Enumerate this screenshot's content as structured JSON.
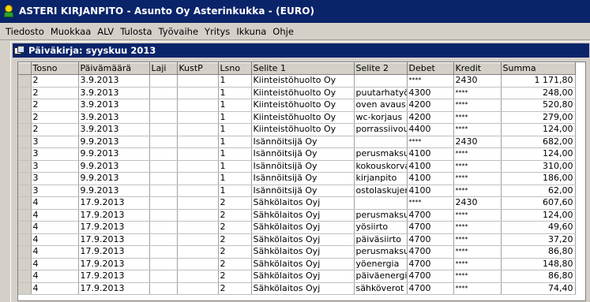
{
  "window": {
    "title": "ASTERI KIRJANPITO - Asunto Oy Asterinkukka - (EURO)"
  },
  "menu": [
    "Tiedosto",
    "Muokkaa",
    "ALV",
    "Tulosta",
    "Työvaihe",
    "Yritys",
    "Ikkuna",
    "Ohje"
  ],
  "child_window": {
    "title": "Päiväkirja: syyskuu 2013"
  },
  "grid": {
    "columns": [
      "Tosno",
      "Päivämäärä",
      "Laji",
      "KustP",
      "Lsno",
      "Selite 1",
      "Selite 2",
      "Debet",
      "Kredit",
      "Summa"
    ],
    "rows": [
      [
        "2",
        "3.9.2013",
        "",
        "",
        "1",
        "Kiinteistöhuolto Oy",
        "",
        "****",
        "2430",
        "1 171,80"
      ],
      [
        "2",
        "3.9.2013",
        "",
        "",
        "1",
        "Kiinteistöhuolto Oy",
        "puutarhatyöt",
        "4300",
        "****",
        "248,00"
      ],
      [
        "2",
        "3.9.2013",
        "",
        "",
        "1",
        "Kiinteistöhuolto Oy",
        "oven avaus",
        "4200",
        "****",
        "520,80"
      ],
      [
        "2",
        "3.9.2013",
        "",
        "",
        "1",
        "Kiinteistöhuolto Oy",
        "wc-korjaus",
        "4200",
        "****",
        "279,00"
      ],
      [
        "2",
        "3.9.2013",
        "",
        "",
        "1",
        "Kiinteistöhuolto Oy",
        "porrassiivous",
        "4400",
        "****",
        "124,00"
      ],
      [
        "3",
        "9.9.2013",
        "",
        "",
        "1",
        "Isännöitsijä Oy",
        "",
        "****",
        "2430",
        "682,00"
      ],
      [
        "3",
        "9.9.2013",
        "",
        "",
        "1",
        "Isännöitsijä Oy",
        "perusmaksu",
        "4100",
        "****",
        "124,00"
      ],
      [
        "3",
        "9.9.2013",
        "",
        "",
        "1",
        "Isännöitsijä Oy",
        "kokouskorva",
        "4100",
        "****",
        "310,00"
      ],
      [
        "3",
        "9.9.2013",
        "",
        "",
        "1",
        "Isännöitsijä Oy",
        "kirjanpito",
        "4100",
        "****",
        "186,00"
      ],
      [
        "3",
        "9.9.2013",
        "",
        "",
        "1",
        "Isännöitsijä Oy",
        "ostolaskujen",
        "4100",
        "****",
        "62,00"
      ],
      [
        "4",
        "17.9.2013",
        "",
        "",
        "2",
        "Sähkölaitos Oyj",
        "",
        "****",
        "2430",
        "607,60"
      ],
      [
        "4",
        "17.9.2013",
        "",
        "",
        "2",
        "Sähkölaitos Oyj",
        "perusmaksu :",
        "4700",
        "****",
        "124,00"
      ],
      [
        "4",
        "17.9.2013",
        "",
        "",
        "2",
        "Sähkölaitos Oyj",
        "yösiirto",
        "4700",
        "****",
        "49,60"
      ],
      [
        "4",
        "17.9.2013",
        "",
        "",
        "2",
        "Sähkölaitos Oyj",
        "päiväsiirto",
        "4700",
        "****",
        "37,20"
      ],
      [
        "4",
        "17.9.2013",
        "",
        "",
        "2",
        "Sähkölaitos Oyj",
        "perusmaksu (",
        "4700",
        "****",
        "86,80"
      ],
      [
        "4",
        "17.9.2013",
        "",
        "",
        "2",
        "Sähkölaitos Oyj",
        "yöenergia",
        "4700",
        "****",
        "148,80"
      ],
      [
        "4",
        "17.9.2013",
        "",
        "",
        "2",
        "Sähkölaitos Oyj",
        "päiväenergia",
        "4700",
        "****",
        "86,80"
      ],
      [
        "4",
        "17.9.2013",
        "",
        "",
        "2",
        "Sähkölaitos Oyj",
        "sähköverot",
        "4700",
        "****",
        "74,40"
      ]
    ]
  }
}
